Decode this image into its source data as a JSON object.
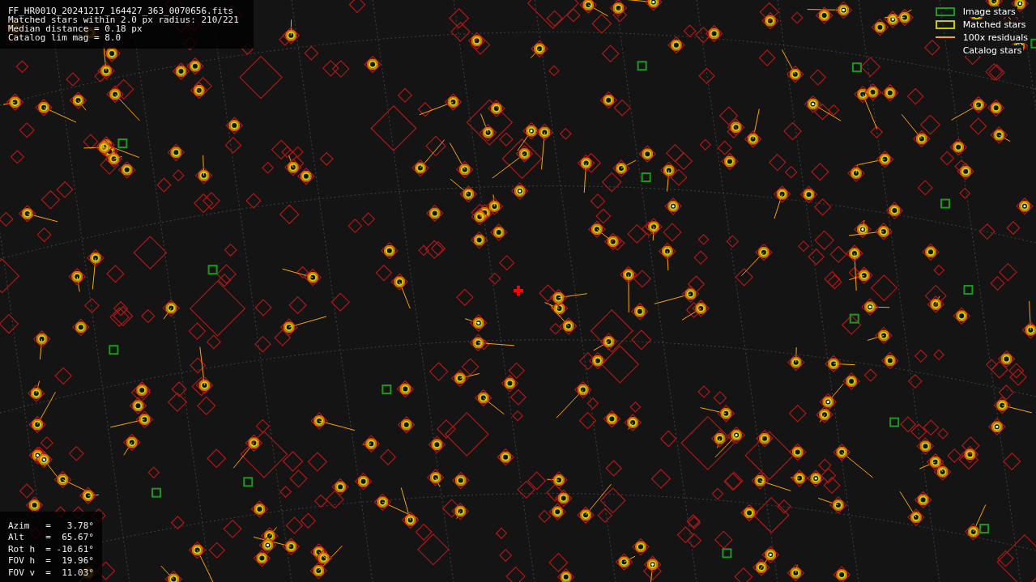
{
  "info": {
    "lines": [
      "FF_HR001Q_20241217_164427_363_0070656.fits",
      "Matched stars within 2.0 px radius: 210/221",
      "Median distance = 0.18 px",
      "Catalog lim mag = 8.0"
    ]
  },
  "legend": [
    {
      "kind": "box",
      "color": "#1a9a1a",
      "label": "Image stars"
    },
    {
      "kind": "box",
      "color": "#c8c800",
      "label": "Matched stars"
    },
    {
      "kind": "line",
      "color": "#ffa500",
      "label": "100x residuals"
    },
    {
      "kind": "none",
      "label": "Catalog stars"
    }
  ],
  "pointing": {
    "lines": [
      "Azim   =   3.78°",
      "Alt    =  65.67°",
      "Rot h  = -10.61°",
      "FOV h  =  19.96°",
      "FOV v  =  11.03°"
    ]
  }
}
